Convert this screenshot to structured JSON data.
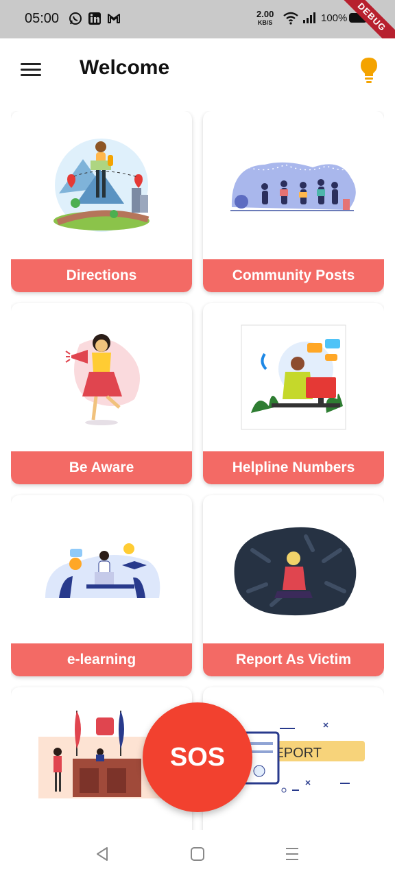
{
  "status_bar": {
    "time": "05:00",
    "speed_value": "2.00",
    "speed_unit": "KB/S",
    "battery": "100%",
    "debug_banner": "DEBUG",
    "notification_icons": [
      "whatsapp-icon",
      "linkedin-icon",
      "gmail-icon"
    ]
  },
  "app_bar": {
    "title": "Welcome",
    "menu_icon": "hamburger-icon",
    "action_icon": "lightbulb-icon",
    "accent": "#f4a300"
  },
  "tiles": [
    {
      "label": "Directions",
      "image": "map-traveler-illustration"
    },
    {
      "label": "Community Posts",
      "image": "community-gathering-illustration"
    },
    {
      "label": "Be Aware",
      "image": "megaphone-woman-illustration"
    },
    {
      "label": "Helpline Numbers",
      "image": "call-center-illustration"
    },
    {
      "label": "e-learning",
      "image": "online-learning-illustration"
    },
    {
      "label": "Report As Victim",
      "image": "victim-hands-illustration"
    },
    {
      "label": "",
      "image": "courtroom-illustration"
    },
    {
      "label": "",
      "image": "report-document-illustration"
    }
  ],
  "sos_button": "SOS",
  "colors": {
    "tile_label_bg": "#f36a65",
    "sos_bg": "#f2412f",
    "status_bar_bg": "#c9c9c9"
  },
  "nav_bar": {
    "back": "back-triangle-icon",
    "home": "home-square-icon",
    "recents": "recents-lines-icon"
  }
}
